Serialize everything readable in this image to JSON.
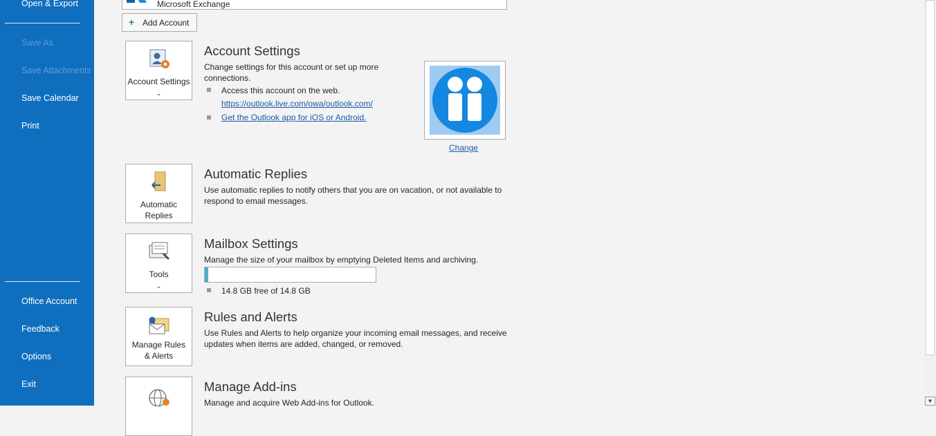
{
  "sidebar": {
    "items": [
      {
        "label": "Open & Export",
        "enabled": true
      },
      {
        "label": "Save As",
        "enabled": false
      },
      {
        "label": "Save Attachments",
        "enabled": false
      },
      {
        "label": "Save Calendar",
        "enabled": true
      },
      {
        "label": "Print",
        "enabled": true
      },
      {
        "label": "Office Account",
        "enabled": true
      },
      {
        "label": "Feedback",
        "enabled": true
      },
      {
        "label": "Options",
        "enabled": true
      },
      {
        "label": "Exit",
        "enabled": true
      }
    ]
  },
  "account": {
    "selected": "Microsoft Exchange",
    "add_label": "Add Account"
  },
  "sections": {
    "account_settings": {
      "tile_label": "Account Settings",
      "title": "Account Settings",
      "description": "Change settings for this account or set up more connections.",
      "bullet1": "Access this account on the web.",
      "web_link": "https://outlook.live.com/owa/outlook.com/",
      "app_link": "Get the Outlook app for iOS or Android.",
      "change_label": "Change"
    },
    "automatic_replies": {
      "tile_label": "Automatic Replies",
      "title": "Automatic Replies",
      "description": "Use automatic replies to notify others that you are on vacation, or not available to respond to email messages."
    },
    "mailbox": {
      "tile_label": "Tools",
      "title": "Mailbox Settings",
      "description": "Manage the size of your mailbox by emptying Deleted Items and archiving.",
      "usage_fraction": 0.02,
      "usage_text": "14.8 GB free of 14.8 GB"
    },
    "rules": {
      "tile_label": "Manage Rules & Alerts",
      "title": "Rules and Alerts",
      "description": "Use Rules and Alerts to help organize your incoming email messages, and receive updates when items are added, changed, or removed."
    },
    "addins": {
      "title": "Manage Add-ins",
      "description": "Manage and acquire Web Add-ins for Outlook."
    }
  },
  "colors": {
    "sidebar_bg": "#106ebe",
    "link": "#1a5aa8",
    "progress": "#4cb0c9"
  }
}
